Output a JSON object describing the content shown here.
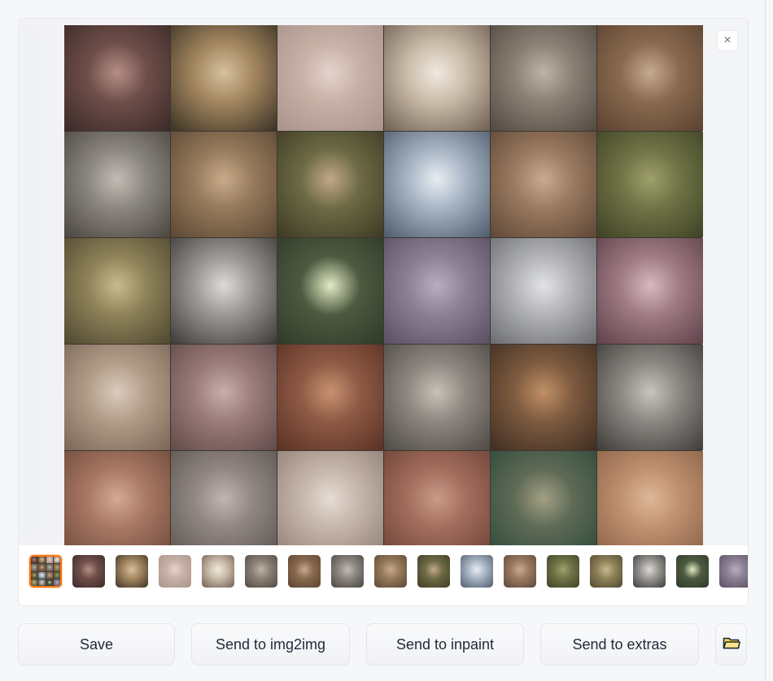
{
  "close_label": "×",
  "preview": {
    "tiles": [
      {
        "colors": [
          "#6f4e4a",
          "#3a2a27",
          "#b58f85"
        ]
      },
      {
        "colors": [
          "#a48760",
          "#3b3224",
          "#d6c0a0"
        ]
      },
      {
        "colors": [
          "#c8b0a6",
          "#a8938b",
          "#e4d3cd"
        ]
      },
      {
        "colors": [
          "#cbbcaa",
          "#6e5f52",
          "#f0e9e0"
        ]
      },
      {
        "colors": [
          "#8a8176",
          "#51483f",
          "#bdb4a7"
        ]
      },
      {
        "colors": [
          "#8a6a4f",
          "#5a4230",
          "#c6aa92"
        ]
      },
      {
        "colors": [
          "#8b8680",
          "#4b4540",
          "#c3bcb4"
        ]
      },
      {
        "colors": [
          "#967a5b",
          "#5b4734",
          "#c8ab8a"
        ]
      },
      {
        "colors": [
          "#6d6a45",
          "#3d3a24",
          "#c3a888"
        ]
      },
      {
        "colors": [
          "#a7b4c4",
          "#4d5b6b",
          "#e8edf2"
        ]
      },
      {
        "colors": [
          "#9b7a60",
          "#5e4736",
          "#c8ab93"
        ]
      },
      {
        "colors": [
          "#6f7345",
          "#3e4226",
          "#9ea06c"
        ]
      },
      {
        "colors": [
          "#8e8258",
          "#4f4731",
          "#c8bb90"
        ]
      },
      {
        "colors": [
          "#9a9893",
          "#3c3a38",
          "#dddbd7"
        ]
      },
      {
        "colors": [
          "#4d5a40",
          "#2f3a28",
          "#e3ebc4"
        ]
      },
      {
        "colors": [
          "#8c8095",
          "#5a4f61",
          "#b9adc0"
        ]
      },
      {
        "colors": [
          "#b2b3b6",
          "#6a6b6f",
          "#e2e3e6"
        ]
      },
      {
        "colors": [
          "#a07b84",
          "#5f4149",
          "#d8b9bf"
        ]
      },
      {
        "colors": [
          "#b39d89",
          "#7a6656",
          "#d9cbbd"
        ]
      },
      {
        "colors": [
          "#9b7c7a",
          "#614a49",
          "#c7aeaa"
        ]
      },
      {
        "colors": [
          "#8f5a45",
          "#5a3124",
          "#c89270"
        ]
      },
      {
        "colors": [
          "#8e8780",
          "#4e4944",
          "#c9c1b8"
        ]
      },
      {
        "colors": [
          "#7e5b3f",
          "#3e2d22",
          "#c09068"
        ]
      },
      {
        "colors": [
          "#8b8782",
          "#3f3c39",
          "#c8c3bc"
        ]
      },
      {
        "colors": [
          "#a87864",
          "#6f4a3a",
          "#d4a994"
        ]
      },
      {
        "colors": [
          "#918782",
          "#5d5551",
          "#c0b6b0"
        ]
      },
      {
        "colors": [
          "#c5b5aa",
          "#8f7f75",
          "#e6dcd4"
        ]
      },
      {
        "colors": [
          "#a46d5d",
          "#6c4336",
          "#c99a88"
        ]
      },
      {
        "colors": [
          "#5e6a56",
          "#2f4a3b",
          "#a3a083"
        ]
      },
      {
        "colors": [
          "#c09070",
          "#8a6247",
          "#ddb898"
        ]
      }
    ]
  },
  "thumbnails": [
    {
      "colors": [
        "#8a6a4f",
        "#3a2a27",
        "#b58f85"
      ],
      "grid": true
    },
    {
      "colors": [
        "#6f4e4a",
        "#3a2a27",
        "#b58f85"
      ]
    },
    {
      "colors": [
        "#a48760",
        "#3b3224",
        "#d6c0a0"
      ]
    },
    {
      "colors": [
        "#c8b0a6",
        "#a8938b",
        "#e4d3cd"
      ]
    },
    {
      "colors": [
        "#cbbcaa",
        "#6e5f52",
        "#f0e9e0"
      ]
    },
    {
      "colors": [
        "#8a8176",
        "#51483f",
        "#bdb4a7"
      ]
    },
    {
      "colors": [
        "#8a6a4f",
        "#5a4230",
        "#c6aa92"
      ]
    },
    {
      "colors": [
        "#8b8680",
        "#4b4540",
        "#c3bcb4"
      ]
    },
    {
      "colors": [
        "#967a5b",
        "#5b4734",
        "#c8ab8a"
      ]
    },
    {
      "colors": [
        "#6d6a45",
        "#3d3a24",
        "#c3a888"
      ]
    },
    {
      "colors": [
        "#a7b4c4",
        "#4d5b6b",
        "#e8edf2"
      ]
    },
    {
      "colors": [
        "#9b7a60",
        "#5e4736",
        "#c8ab93"
      ]
    },
    {
      "colors": [
        "#6f7345",
        "#3e4226",
        "#9ea06c"
      ]
    },
    {
      "colors": [
        "#8e8258",
        "#4f4731",
        "#c8bb90"
      ]
    },
    {
      "colors": [
        "#9a9893",
        "#3c3a38",
        "#dddbd7"
      ]
    },
    {
      "colors": [
        "#4d5a40",
        "#2f3a28",
        "#e3ebc4"
      ]
    },
    {
      "colors": [
        "#8c8095",
        "#5a4f61",
        "#b9adc0"
      ]
    }
  ],
  "buttons": {
    "save": "Save",
    "send_img2img": "Send to img2img",
    "send_inpaint": "Send to inpaint",
    "send_extras": "Send to extras"
  },
  "folder_icon": "open-folder-icon",
  "accent_color": "#f97316"
}
